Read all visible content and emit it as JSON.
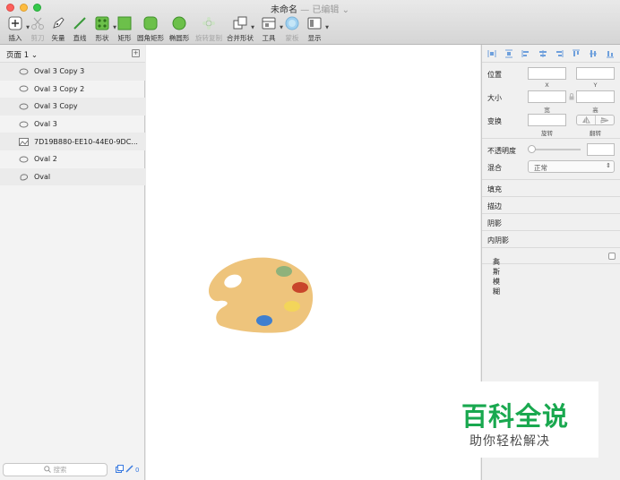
{
  "window": {
    "title": "未命名",
    "separator": "—",
    "status": "已编辑",
    "status_caret": "⌄"
  },
  "toolbar": {
    "items": [
      {
        "label": "插入",
        "icon": "plus-icon",
        "dim": false,
        "caret": true
      },
      {
        "label": "剪刀",
        "icon": "scissors-icon",
        "dim": true,
        "caret": false
      },
      {
        "label": "矢量",
        "icon": "pen-icon",
        "dim": false,
        "caret": false
      },
      {
        "label": "直线",
        "icon": "line-icon",
        "dim": false,
        "caret": false
      },
      {
        "label": "形状",
        "icon": "shapes-icon",
        "dim": false,
        "caret": true
      },
      {
        "label": "矩形",
        "icon": "rectangle-icon",
        "dim": false,
        "caret": false
      },
      {
        "label": "圆角矩形",
        "icon": "rounded-rectangle-icon",
        "dim": false,
        "caret": false
      },
      {
        "label": "椭圆形",
        "icon": "oval-icon",
        "dim": false,
        "caret": false
      },
      {
        "label": "旋转复制",
        "icon": "rotate-copy-icon",
        "dim": true,
        "caret": false
      },
      {
        "label": "合并形状",
        "icon": "combine-shapes-icon",
        "dim": false,
        "caret": true
      },
      {
        "label": "工具",
        "icon": "tools-icon",
        "dim": false,
        "caret": true
      },
      {
        "label": "蒙板",
        "icon": "mask-icon",
        "dim": true,
        "caret": false
      },
      {
        "label": "显示",
        "icon": "view-icon",
        "dim": false,
        "caret": true
      }
    ]
  },
  "pages": {
    "current": "页面 1",
    "caret": "⌄",
    "add_glyph": "+"
  },
  "layers": [
    {
      "name": "Oval 3 Copy 3",
      "kind": "oval"
    },
    {
      "name": "Oval 3 Copy 2",
      "kind": "oval"
    },
    {
      "name": "Oval 3 Copy",
      "kind": "oval"
    },
    {
      "name": "Oval 3",
      "kind": "oval"
    },
    {
      "name": "7D19B880-EE10-44E0-9DC...",
      "kind": "bitmap"
    },
    {
      "name": "Oval 2",
      "kind": "oval"
    },
    {
      "name": "Oval",
      "kind": "oval"
    }
  ],
  "search": {
    "placeholder": "搜索"
  },
  "layer_footer": {
    "count": "0"
  },
  "inspector": {
    "position_label": "位置",
    "x_cap": "X",
    "y_cap": "Y",
    "size_label": "大小",
    "width_cap": "宽",
    "height_cap": "高",
    "transform_label": "变换",
    "rotate_cap": "旋转",
    "flip_cap": "翻转",
    "opacity_label": "不透明度",
    "blend_label": "混合",
    "blend_value": "正常",
    "sections": [
      "填充",
      "描边",
      "阴影",
      "内阴影"
    ],
    "blur_label": "高斯模糊"
  },
  "palette_colors": {
    "body": "#eec47c",
    "green": "#8fb27b",
    "red": "#c8452b",
    "yellow": "#f3d55a",
    "blue": "#3f7fcf"
  },
  "watermark": {
    "brand": "百科全说",
    "slogan": "助你轻松解决",
    "color": "#19a84f"
  }
}
